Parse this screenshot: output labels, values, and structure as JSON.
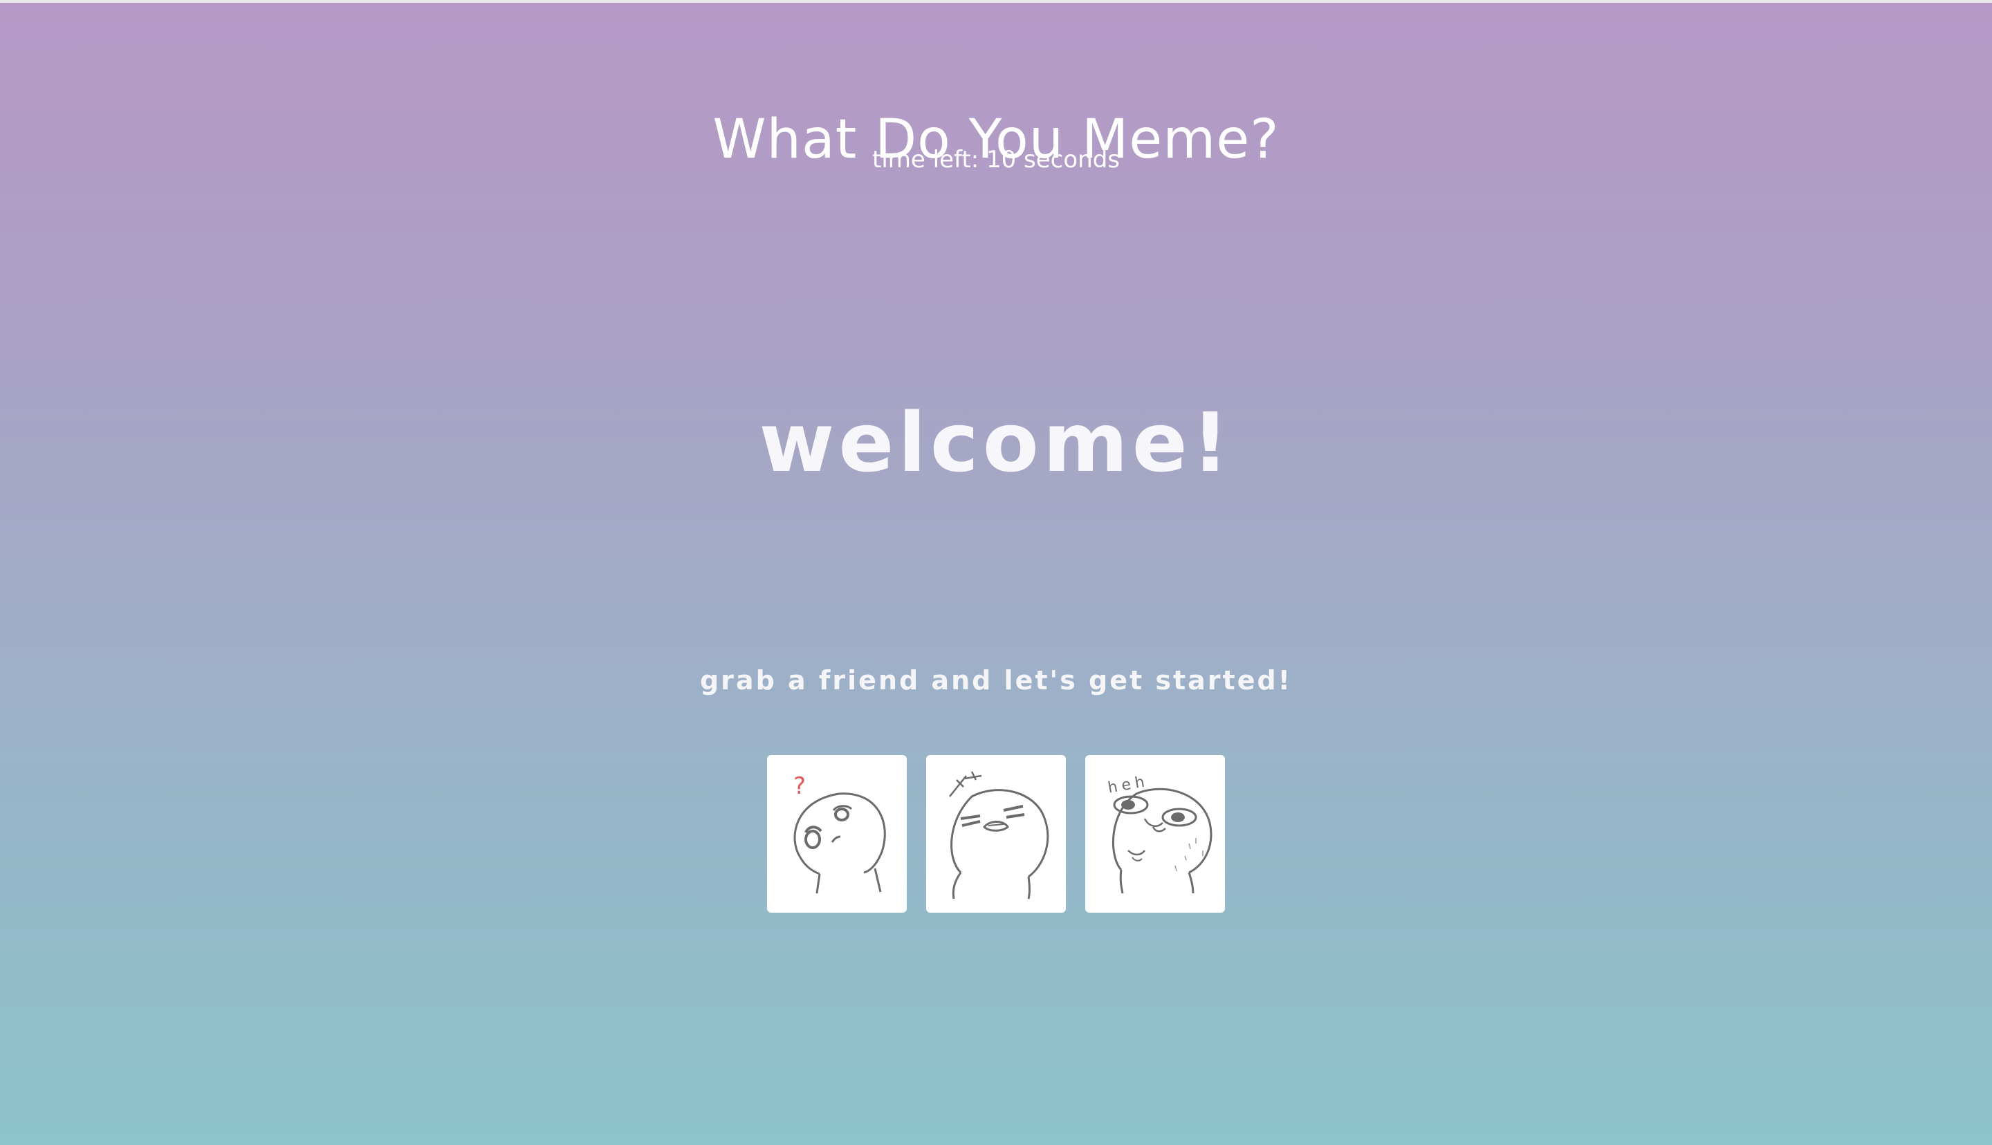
{
  "header": {
    "title": "What Do You Meme?",
    "timer_text": "time left: 10 seconds"
  },
  "main": {
    "welcome": "welcome!",
    "tagline": "grab a friend and let's get started!"
  },
  "cards": [
    {
      "icon": "confused-face-icon",
      "mark": "?"
    },
    {
      "icon": "annoyed-face-icon",
      "mark": "++"
    },
    {
      "icon": "smug-face-icon",
      "mark": "heh"
    }
  ],
  "colors": {
    "gradient_top": "#b697c5",
    "gradient_bottom": "#8cc3cc",
    "text": "#ffffff",
    "card_bg": "#ffffff",
    "sketch_stroke": "#6b6b6b",
    "question_mark": "#e05a5a"
  }
}
